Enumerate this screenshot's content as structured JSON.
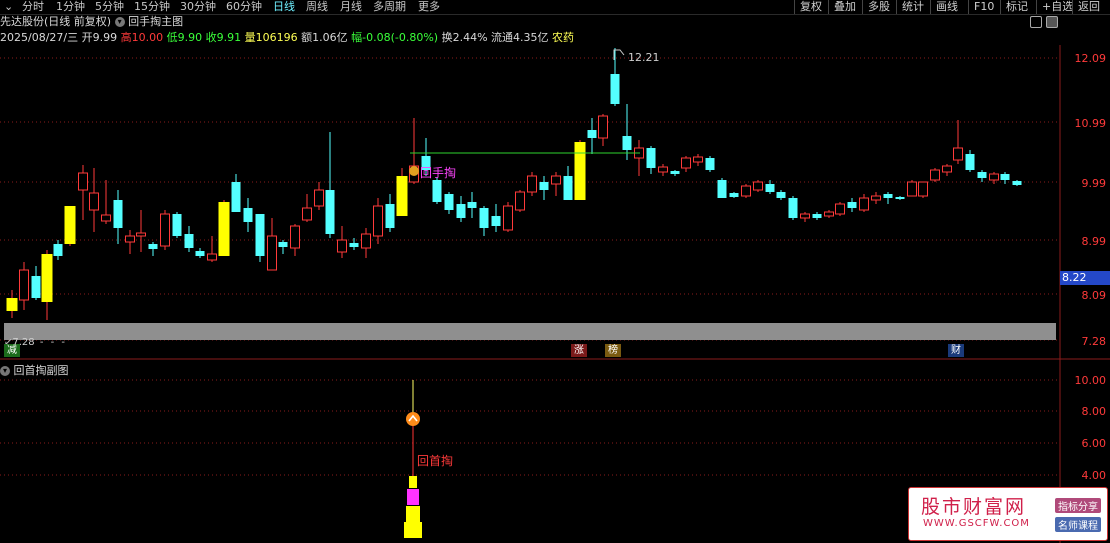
{
  "toolbar": {
    "tabs": [
      "分时",
      "1分钟",
      "5分钟",
      "15分钟",
      "30分钟",
      "60分钟",
      "日线",
      "周线",
      "月线",
      "多周期",
      "更多"
    ],
    "active_tab": "日线",
    "right_buttons": [
      "复权",
      "叠加",
      "多股",
      "统计",
      "画线",
      "F10",
      "标记",
      "+自选",
      "返回"
    ]
  },
  "header": {
    "stock_name": "先达股份(日线 前复权)",
    "indicator_name": "回手掏主图"
  },
  "quote": {
    "date": "2025/08/27/三",
    "open_label": "开",
    "open": "9.99",
    "high_label": "高",
    "high": "10.00",
    "low_label": "低",
    "low": "9.90",
    "close_label": "收",
    "close": "9.91",
    "volume_label": "量",
    "volume": "106196",
    "amount_label": "额",
    "amount": "1.06亿",
    "change_label": "幅",
    "change": "-0.08(-0.80%)",
    "turnover_label": "换",
    "turnover": "2.44%",
    "float_label": "流通",
    "float_cap": "4.35亿",
    "sector": "农药"
  },
  "price_axis": [
    "12.09",
    "10.99",
    "9.99",
    "8.99",
    "8.09",
    "7.28"
  ],
  "current_price": "8.22",
  "annotations": {
    "peak_price": "12.21",
    "low_price": "7.28",
    "signal_main": "回手掏",
    "badge_reduce": "减",
    "badge_limit_up": "涨",
    "badge_list": "榜",
    "badge_finance": "财"
  },
  "sub_chart": {
    "title": "回首掏副图",
    "axis": [
      "10.00",
      "8.00",
      "6.00",
      "4.00"
    ],
    "signal": "回首掏"
  },
  "watermark": {
    "title": "股市财富网",
    "url": "WWW.GSCFW.COM",
    "tag1": "指标分享",
    "tag2": "名师课程"
  },
  "colors": {
    "up": "#ff3a3a",
    "down": "#54ffff",
    "signal_bar": "#ffff00",
    "magenta": "#ff33ff"
  }
}
